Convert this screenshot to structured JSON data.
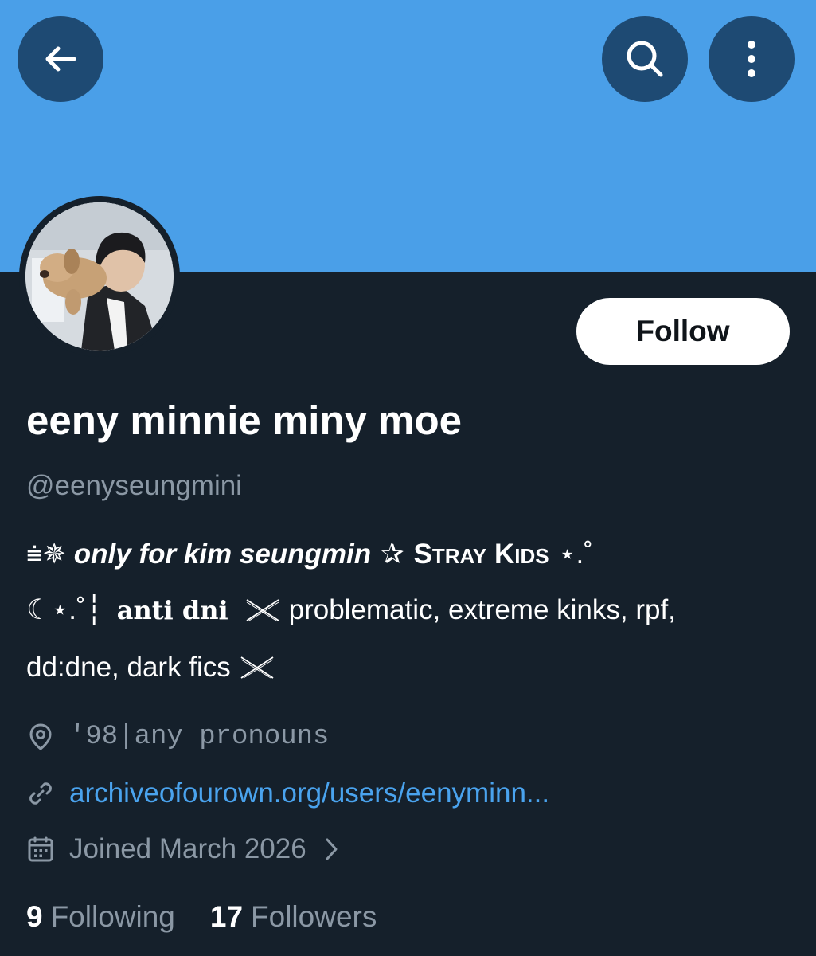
{
  "header": {
    "back_icon": "arrow-left-icon",
    "search_icon": "search-icon",
    "more_icon": "more-vertical-icon",
    "banner_color": "#4a9fe8",
    "button_bg_color": "#1e4a73"
  },
  "profile": {
    "avatar_icon": "profile-avatar",
    "follow_label": "Follow",
    "display_name": "eeny minnie miny moe",
    "handle": "@eenyseungmini"
  },
  "bio": {
    "line1": {
      "prefix_glyph": "⩧✵",
      "italic_text": "only for kim seungmin",
      "star_glyph": "✰",
      "stray_S": "S",
      "stray_rest": "TRAY",
      "kids_K": "K",
      "kids_rest": "IDS",
      "suffix_glyph": "⋆.˚"
    },
    "line2": {
      "prefix_glyph": "☾⋆.˚┆",
      "anti_dni": "anti dni",
      "rest": "problematic, extreme kinks, rpf,"
    },
    "line3": {
      "text": "dd:dne, dark fics"
    }
  },
  "meta": {
    "location": "'98|any pronouns",
    "link": "archiveofourown.org/users/eenyminn...",
    "joined": "Joined March 2026"
  },
  "stats": {
    "following_count": "9",
    "following_label": "Following",
    "followers_count": "17",
    "followers_label": "Followers"
  },
  "colors": {
    "background": "#15202b",
    "secondary_text": "#8b98a5",
    "link": "#4aa3ee"
  }
}
